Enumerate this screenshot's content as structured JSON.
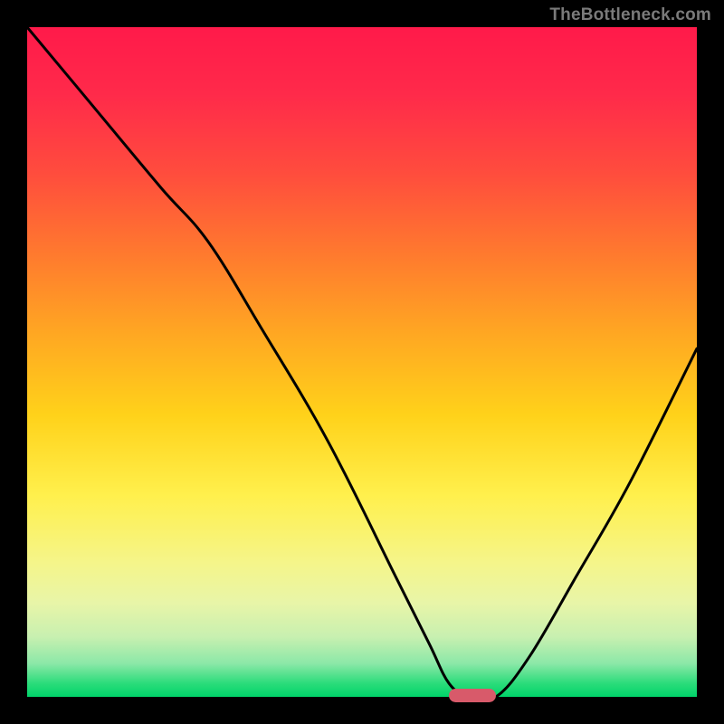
{
  "watermark": "TheBottleneck.com",
  "chart_data": {
    "type": "line",
    "title": "",
    "xlabel": "",
    "ylabel": "",
    "xlim": [
      0,
      100
    ],
    "ylim": [
      0,
      100
    ],
    "grid": false,
    "legend": false,
    "series": [
      {
        "name": "bottleneck-curve",
        "x": [
          0,
          10,
          20,
          27,
          35,
          45,
          55,
          60,
          63,
          66,
          70,
          75,
          82,
          90,
          100
        ],
        "y": [
          100,
          88,
          76,
          68,
          55,
          38,
          18,
          8,
          2,
          0,
          0,
          6,
          18,
          32,
          52
        ]
      }
    ],
    "background_gradient": {
      "top": "#ff1a4a",
      "mid": "#ffd21a",
      "bottom": "#00d46a"
    },
    "optimal_marker": {
      "x_start": 63,
      "x_end": 70,
      "y": 0,
      "color": "#d85a6a"
    }
  }
}
